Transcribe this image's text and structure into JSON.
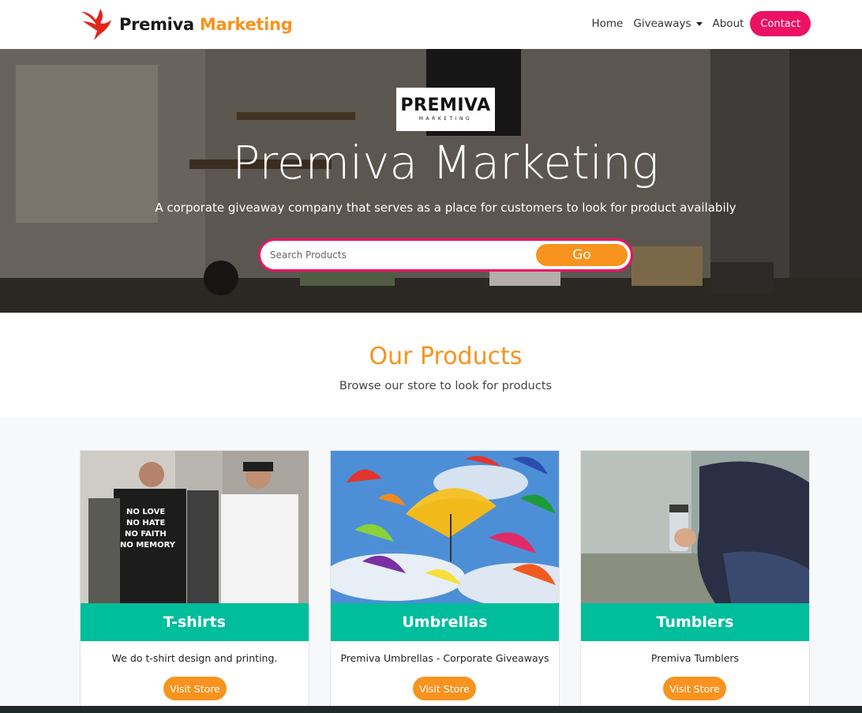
{
  "navbar": {
    "brand_part1": "Premiva",
    "brand_part2": "Marketing",
    "links": [
      {
        "label": "Home"
      },
      {
        "label": "Giveaways"
      },
      {
        "label": "About"
      }
    ],
    "contact_label": "Contact"
  },
  "hero": {
    "logo_word": "PREMIVA",
    "logo_sub": "MARKETING",
    "title": "Premiva Marketing",
    "subtitle": "A corporate giveaway company that serves as a place for customers to look for product availabily",
    "search_placeholder": "Search Products",
    "search_button": "Go"
  },
  "products": {
    "title": "Our Products",
    "subtitle": "Browse our store to look for products",
    "items": [
      {
        "name": "T-shirts",
        "desc": "We do t-shirt design and printing.",
        "button": "Visit Store"
      },
      {
        "name": "Umbrellas",
        "desc": "Premiva Umbrellas - Corporate Giveaways",
        "button": "Visit Store"
      },
      {
        "name": "Tumblers",
        "desc": "Premiva Tumblers",
        "button": "Visit Store"
      }
    ],
    "tshirt_print": [
      "NO LOVE",
      "NO HATE",
      "NO FAITH",
      "NO MEMORY"
    ]
  },
  "colors": {
    "brand_orange": "#f7931e",
    "brand_pink": "#ed1164",
    "teal": "#00bd9c"
  }
}
